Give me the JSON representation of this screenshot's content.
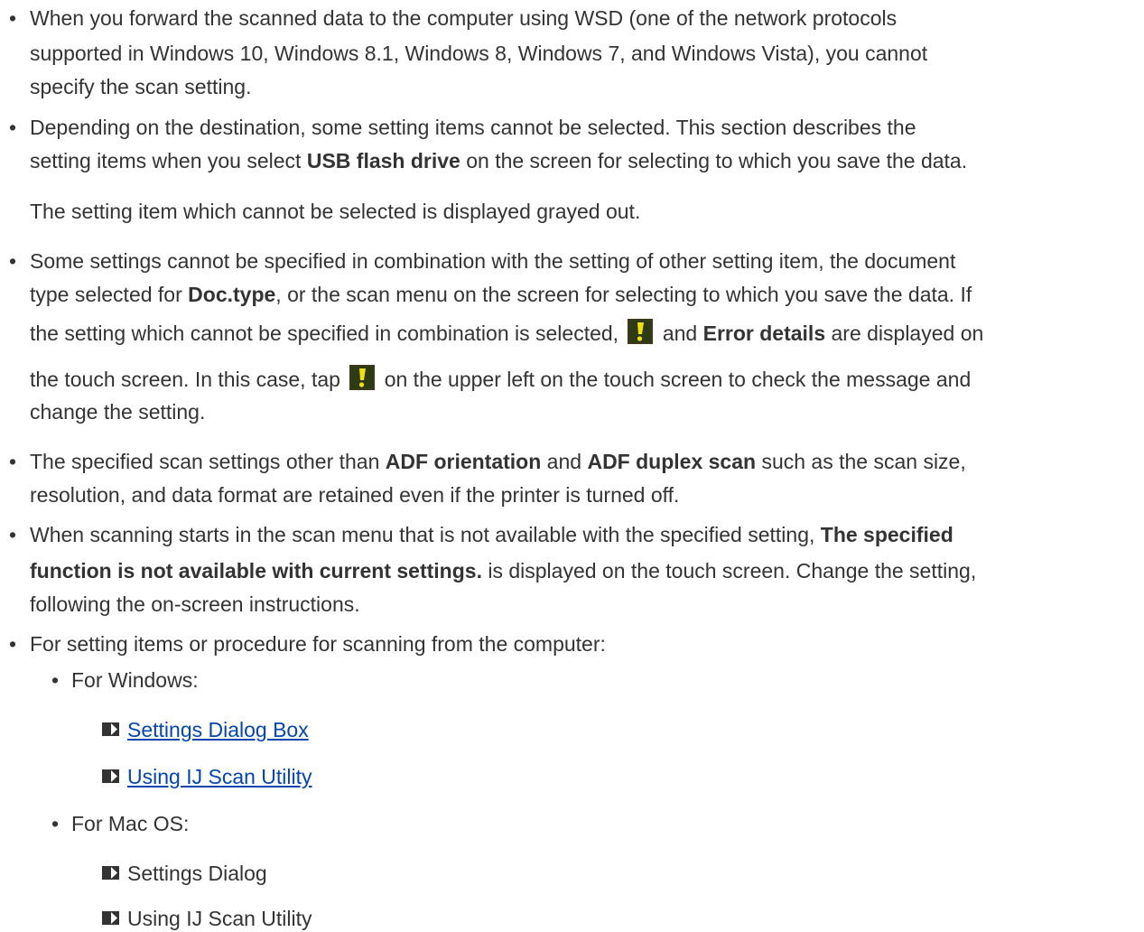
{
  "notes": {
    "item1": {
      "lines": [
        "When you forward the scanned data to the computer using WSD (one of the network protocols",
        "supported in Windows 10, Windows 8.1, Windows 8, Windows 7, and Windows Vista), you cannot",
        "specify the scan setting."
      ]
    },
    "item2": {
      "line1": "Depending on the destination, some setting items cannot be selected. This section describes the",
      "line2_pre": "setting items when you select ",
      "line2_bold": "USB flash drive",
      "line2_post": " on the screen for selecting to which you save the data.",
      "sub": "The setting item which cannot be selected is displayed grayed out."
    },
    "item3": {
      "line1": "Some settings cannot be specified in combination with the setting of other setting item, the document",
      "line2_pre": "type selected for ",
      "line2_bold": "Doc.type",
      "line2_post": ", or the scan menu on the screen for selecting to which you save the data. If",
      "line3_pre": "the setting which cannot be specified in combination is selected, ",
      "line3_mid": " and ",
      "line3_bold": "Error details",
      "line3_post": " are displayed on",
      "line4_pre": "the touch screen. In this case, tap ",
      "line4_post": " on the upper left on the touch screen to check the message and",
      "line5": "change the setting."
    },
    "item4": {
      "line1_pre": "The specified scan settings other than ",
      "line1_bold1": "ADF orientation",
      "line1_mid": " and ",
      "line1_bold2": "ADF duplex scan",
      "line1_post": " such as the scan size,",
      "line2": "resolution, and data format are retained even if the printer is turned off."
    },
    "item5": {
      "line1_pre": "When scanning starts in the scan menu that is not available with the specified setting, ",
      "line1_bold": "The specified",
      "line2_bold": "function is not available with current settings.",
      "line2_post": " is displayed on the touch screen. Change the setting,",
      "line3": "following the on-screen instructions."
    },
    "item6": {
      "text": "For setting items or procedure for scanning from the computer:",
      "windows": {
        "label": "For Windows:",
        "links": [
          "Settings Dialog Box",
          "Using IJ Scan Utility"
        ]
      },
      "mac": {
        "label": "For Mac OS:",
        "links": [
          "Settings Dialog",
          "Using IJ Scan Utility"
        ]
      }
    }
  },
  "colors": {
    "text": "#333333",
    "link": "#0645ad",
    "arrow_icon": "#333333",
    "warning_bg": "#3a3a1a",
    "warning_fg": "#f0e010"
  },
  "icons": {
    "bullet": "bullet-dot",
    "link_marker": "link-arrow-icon",
    "warning": "warning-exclamation-icon"
  }
}
